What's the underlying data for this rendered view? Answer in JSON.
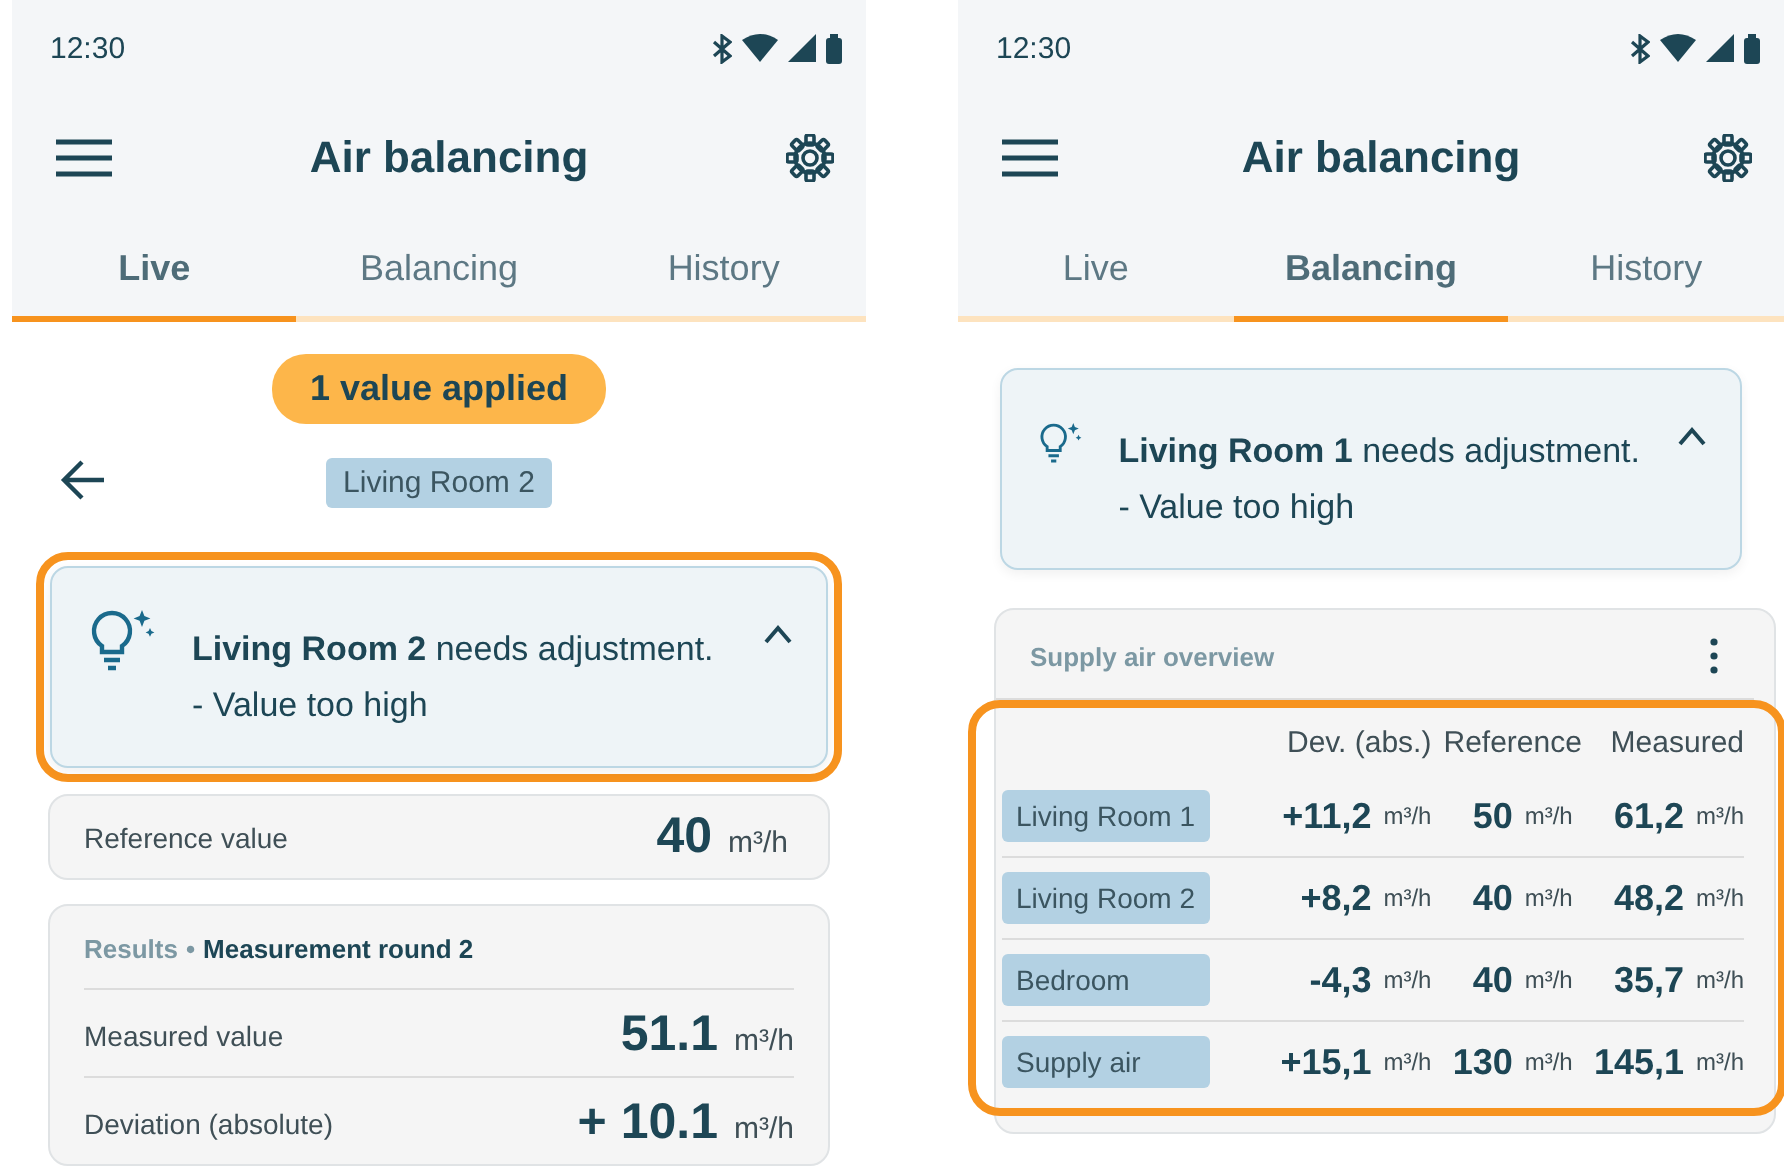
{
  "screens": [
    {
      "status_bar": {
        "time": "12:30"
      },
      "app_bar": {
        "title": "Air balancing"
      },
      "tabs": [
        {
          "label": "Live",
          "selected": true
        },
        {
          "label": "Balancing",
          "selected": false
        },
        {
          "label": "History",
          "selected": false
        }
      ],
      "banner": "1 value applied",
      "room_chip": "Living Room 2",
      "hint": {
        "text": "**Living Room 2** needs adjustment.",
        "detail": "- Value too high",
        "expanded": true,
        "highlighted": true
      },
      "reference": {
        "label": "Reference value",
        "value": "40",
        "unit": "m³/h"
      },
      "results": {
        "title": "Results",
        "separator": "•",
        "subtitle": "Measurement round 2",
        "rows": [
          {
            "label": "Measured value",
            "value": "51.1",
            "unit": "m³/h"
          },
          {
            "label": "Deviation (absolute)",
            "value": "+ 10.1",
            "unit": "m³/h"
          }
        ]
      }
    },
    {
      "status_bar": {
        "time": "12:30"
      },
      "app_bar": {
        "title": "Air balancing"
      },
      "tabs": [
        {
          "label": "Live",
          "selected": false
        },
        {
          "label": "Balancing",
          "selected": true
        },
        {
          "label": "History",
          "selected": false
        }
      ],
      "hint": {
        "text": "**Living Room 1** needs adjustment.",
        "detail": "- Value too high",
        "expanded": true,
        "highlighted": false
      },
      "overview": {
        "title": "Supply air overview",
        "highlighted": true,
        "columns": [
          "Dev. (abs.)",
          "Reference",
          "Measured"
        ],
        "rows": [
          {
            "room": "Living Room 1",
            "cells": [
              {
                "value": "+11,2",
                "unit": "m³/h"
              },
              {
                "value": "50",
                "unit": "m³/h"
              },
              {
                "value": "61,2",
                "unit": "m³/h"
              }
            ]
          },
          {
            "room": "Living Room 2",
            "cells": [
              {
                "value": "+8,2",
                "unit": "m³/h"
              },
              {
                "value": "40",
                "unit": "m³/h"
              },
              {
                "value": "48,2",
                "unit": "m³/h"
              }
            ]
          },
          {
            "room": "Bedroom",
            "cells": [
              {
                "value": "-4,3",
                "unit": "m³/h"
              },
              {
                "value": "40",
                "unit": "m³/h"
              },
              {
                "value": "35,7",
                "unit": "m³/h"
              }
            ]
          },
          {
            "room": "Supply air",
            "cells": [
              {
                "value": "+15,1",
                "unit": "m³/h"
              },
              {
                "value": "130",
                "unit": "m³/h"
              },
              {
                "value": "145,1",
                "unit": "m³/h"
              }
            ]
          }
        ]
      }
    }
  ]
}
